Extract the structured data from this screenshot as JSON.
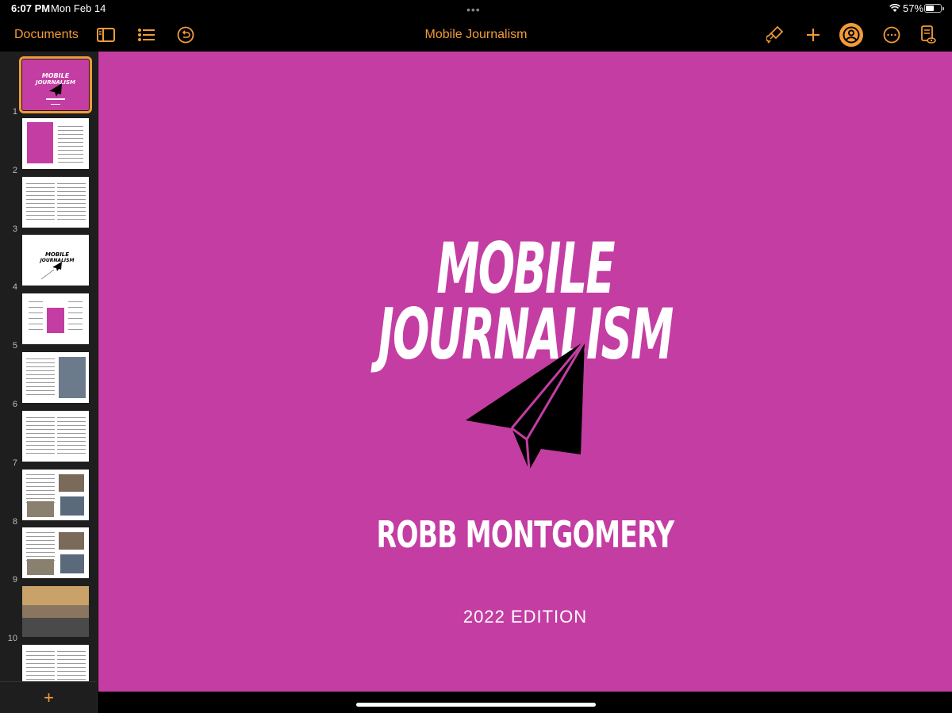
{
  "status_bar": {
    "time": "6:07 PM",
    "date": "Mon Feb 14",
    "battery_percent": "57%",
    "battery_level": 0.57
  },
  "toolbar": {
    "documents_label": "Documents",
    "title": "Mobile Journalism",
    "accent_color": "#f29b38"
  },
  "sidebar": {
    "slides": [
      {
        "number": "1",
        "kind": "cover",
        "selected": true
      },
      {
        "number": "2",
        "kind": "contents"
      },
      {
        "number": "3",
        "kind": "text"
      },
      {
        "number": "4",
        "kind": "logo"
      },
      {
        "number": "5",
        "kind": "roadmap"
      },
      {
        "number": "6",
        "kind": "photo-text"
      },
      {
        "number": "7",
        "kind": "text"
      },
      {
        "number": "8",
        "kind": "photos"
      },
      {
        "number": "9",
        "kind": "photos"
      },
      {
        "number": "10",
        "kind": "landscape"
      },
      {
        "number": "",
        "kind": "text"
      }
    ],
    "add_label": "+"
  },
  "cover": {
    "title_line_1": "MOBILE",
    "title_line_2": "JOURNALISM",
    "author": "ROBB MONTGOMERY",
    "edition": "2022 EDITION",
    "background_color": "#c43da3"
  }
}
